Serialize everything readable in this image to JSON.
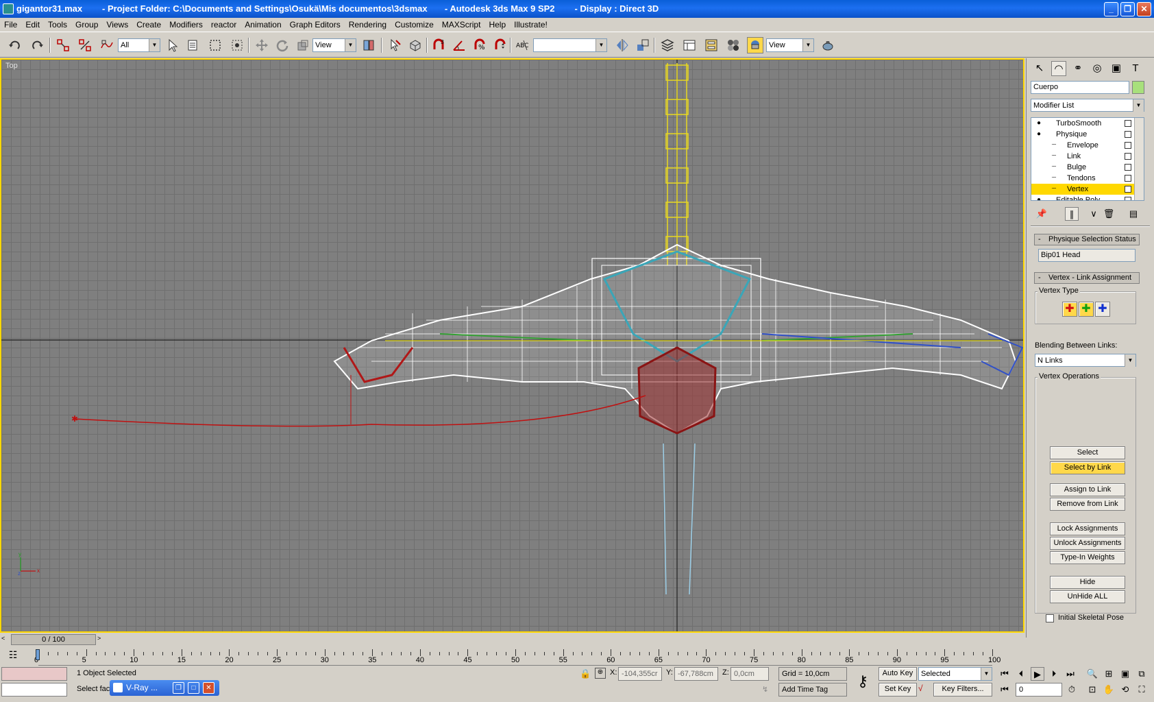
{
  "window": {
    "title_file": "gigantor31.max",
    "title_project": "- Project Folder: C:\\Documents and Settings\\Osukä\\Mis documentos\\3dsmax",
    "title_app": "- Autodesk 3ds Max 9 SP2",
    "title_display": "- Display : Direct 3D"
  },
  "menu": [
    "File",
    "Edit",
    "Tools",
    "Group",
    "Views",
    "Create",
    "Modifiers",
    "reactor",
    "Animation",
    "Graph Editors",
    "Rendering",
    "Customize",
    "MAXScript",
    "Help",
    "Illustrate!"
  ],
  "toolbar": {
    "selection_filter": "All",
    "ref_coord": "View",
    "named_selection": "",
    "render_preset": "View"
  },
  "viewport": {
    "label": "Top",
    "axis_x": "x",
    "axis_y": "y",
    "axis_z": "z"
  },
  "panel": {
    "object_name": "Cuerpo",
    "object_color": "#a8e07c",
    "modifier_list": "Modifier List",
    "stack": [
      {
        "label": "TurboSmooth",
        "indent": 0,
        "selected": false
      },
      {
        "label": "Physique",
        "indent": 0,
        "selected": false
      },
      {
        "label": "Envelope",
        "indent": 1,
        "selected": false
      },
      {
        "label": "Link",
        "indent": 1,
        "selected": false
      },
      {
        "label": "Bulge",
        "indent": 1,
        "selected": false
      },
      {
        "label": "Tendons",
        "indent": 1,
        "selected": false
      },
      {
        "label": "Vertex",
        "indent": 1,
        "selected": true
      },
      {
        "label": "Editable Poly",
        "indent": 0,
        "selected": false
      }
    ],
    "rollout_status": "Physique Selection Status",
    "status_value": "Bip01 Head",
    "rollout_vertex": "Vertex - Link Assignment",
    "vertex_type_label": "Vertex Type",
    "blending_label": "Blending Between Links:",
    "blending_value": "N Links",
    "vertex_ops_label": "Vertex Operations",
    "buttons": {
      "select": "Select",
      "select_by_link": "Select by Link",
      "assign": "Assign to Link",
      "remove": "Remove from Link",
      "lock": "Lock Assignments",
      "unlock": "Unlock Assignments",
      "typein": "Type-In Weights",
      "hide": "Hide",
      "unhide": "UnHide ALL"
    },
    "initial_pose": "Initial Skeletal Pose"
  },
  "timeline": {
    "frame_display": "0 / 100",
    "ticks": [
      "0",
      "5",
      "10",
      "15",
      "20",
      "25",
      "30",
      "35",
      "40",
      "45",
      "50",
      "55",
      "60",
      "65",
      "70",
      "75",
      "80",
      "85",
      "90",
      "95",
      "100"
    ]
  },
  "status": {
    "selected": "1 Object Selected",
    "prompt": "Select fac",
    "x_label": "X:",
    "x": "-104,355cr",
    "y_label": "Y:",
    "y": "-67,788cm",
    "z_label": "Z:",
    "z": "0,0cm",
    "grid": "Grid = 10,0cm",
    "add_time_tag": "Add Time Tag",
    "auto_key": "Auto Key",
    "set_key": "Set Key",
    "key_mode": "Selected",
    "key_filters": "Key Filters...",
    "current_frame": "0",
    "taskbar_item": "V-Ray ..."
  }
}
